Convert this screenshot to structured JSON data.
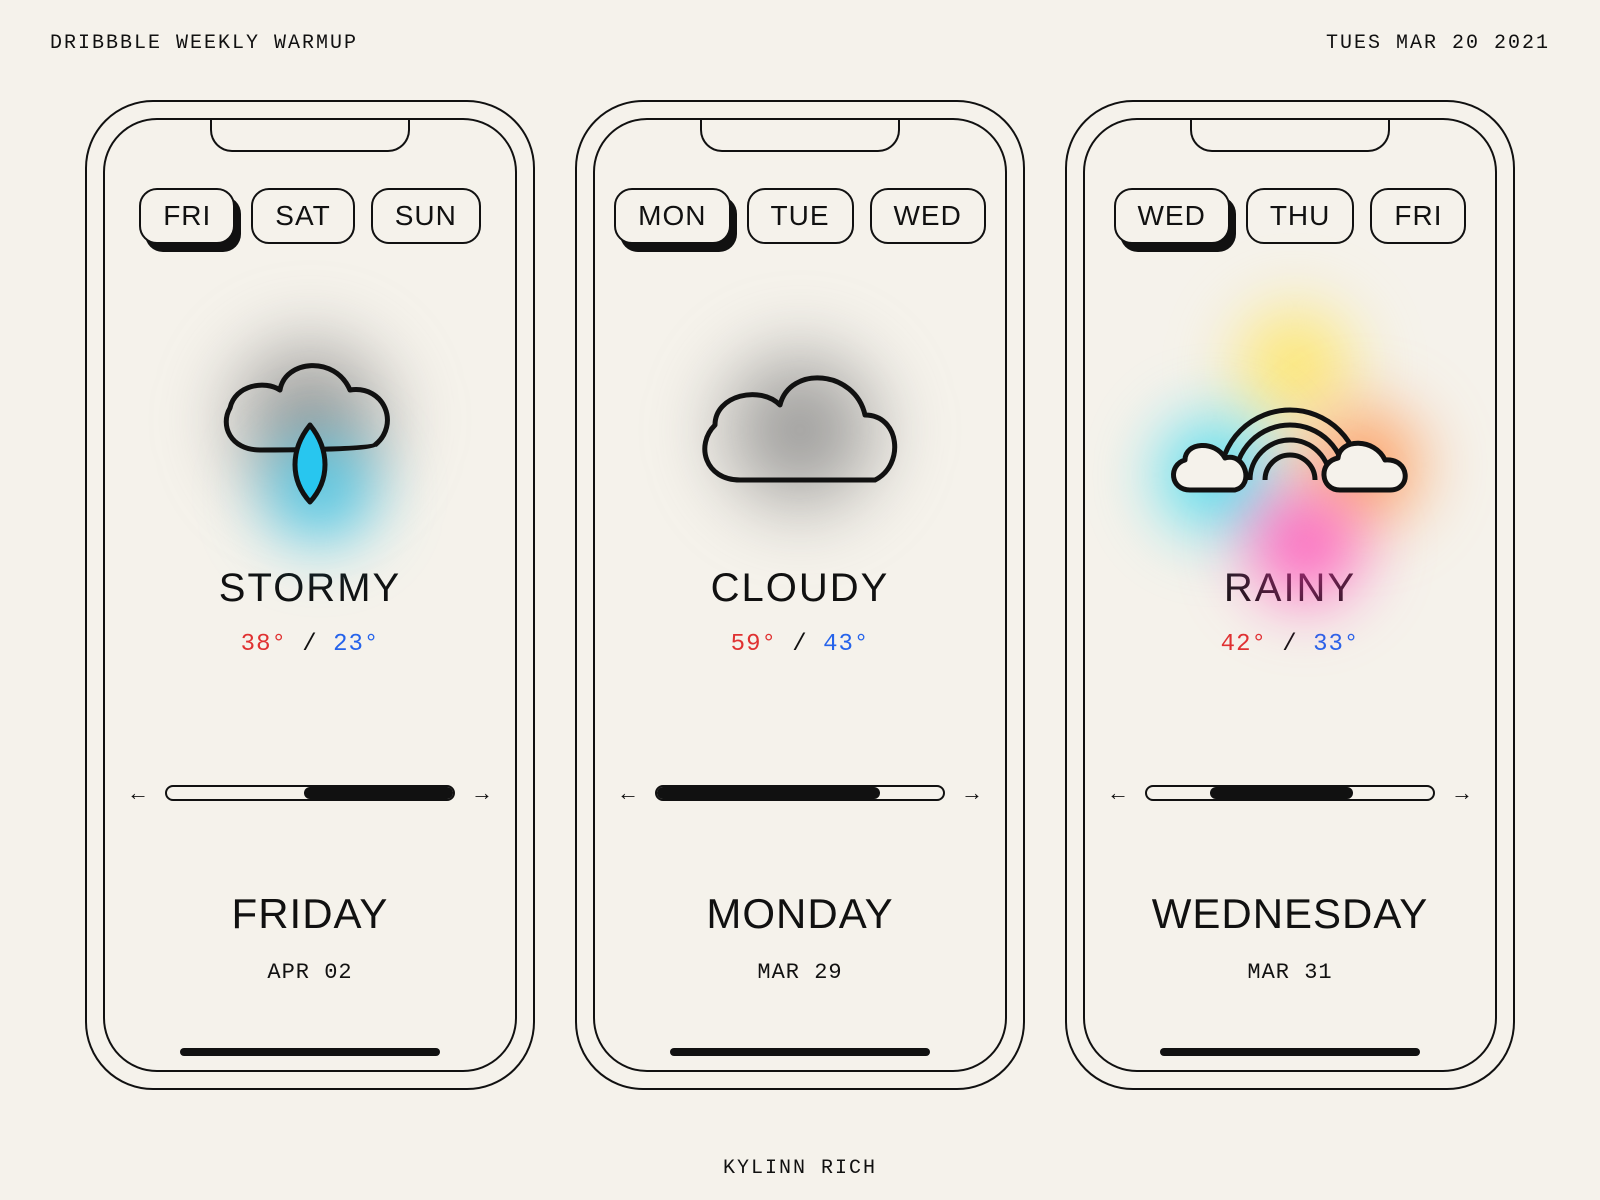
{
  "header": {
    "left": "DRIBBBLE WEEKLY WARMUP",
    "right": "TUES MAR 20 2021"
  },
  "credit": "KYLINN RICH",
  "phones": [
    {
      "tabs": [
        "FRI",
        "SAT",
        "SUN"
      ],
      "activeTab": 0,
      "icon": "stormy",
      "condition": "STORMY",
      "hi": "38°",
      "lo": "23°",
      "slider": {
        "start": 48,
        "end": 100
      },
      "dayName": "FRIDAY",
      "dayDate": "APR 02"
    },
    {
      "tabs": [
        "MON",
        "TUE",
        "WED"
      ],
      "activeTab": 0,
      "icon": "cloudy",
      "condition": "CLOUDY",
      "hi": "59°",
      "lo": "43°",
      "slider": {
        "start": 0,
        "end": 78
      },
      "dayName": "MONDAY",
      "dayDate": "MAR 29"
    },
    {
      "tabs": [
        "WED",
        "THU",
        "FRI"
      ],
      "activeTab": 0,
      "icon": "rainy",
      "condition": "RAINY",
      "hi": "42°",
      "lo": "33°",
      "slider": {
        "start": 22,
        "end": 72
      },
      "dayName": "WEDNESDAY",
      "dayDate": "MAR 31"
    }
  ]
}
